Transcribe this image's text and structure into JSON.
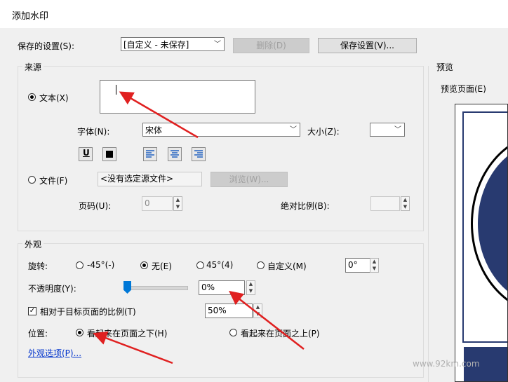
{
  "window": {
    "title": "添加水印"
  },
  "settings": {
    "saved_label": "保存的设置(S):",
    "saved_value": "[自定义 - 未保存]",
    "delete_label": "删除(D)",
    "save_label": "保存设置(V)..."
  },
  "source": {
    "group_title": "来源",
    "text_option": "文本(X)",
    "text_value": "",
    "font_label": "字体(N):",
    "font_value": "宋体",
    "size_label": "大小(Z):",
    "size_value": "",
    "file_option": "文件(F)",
    "file_value": "<没有选定源文件>",
    "browse_label": "浏览(W)...",
    "page_label": "页码(U):",
    "page_value": "0",
    "scale_label": "绝对比例(B):",
    "scale_value": ""
  },
  "appearance": {
    "group_title": "外观",
    "rotation_label": "旋转:",
    "rot_neg45": "-45°(-)",
    "rot_none": "无(E)",
    "rot_pos45": "45°(4)",
    "rot_custom": "自定义(M)",
    "rot_value": "0°",
    "opacity_label": "不透明度(Y):",
    "opacity_value": "0%",
    "opacity_level": 0,
    "relative_label": "相对于目标页面的比例(T)",
    "relative_checked": true,
    "relative_value": "50%",
    "position_label": "位置:",
    "pos_behind": "看起来在页面之下(H)",
    "pos_front": "看起来在页面之上(P)",
    "options_link": "外观选项(P)..."
  },
  "preview": {
    "title": "预览",
    "page_label": "预览页面(E)"
  },
  "overlay": {
    "watermark": "www.92km.com"
  },
  "colors": {
    "arrow": "#e02020",
    "preview_circle": "#283a70",
    "accent": "#0078d7"
  }
}
